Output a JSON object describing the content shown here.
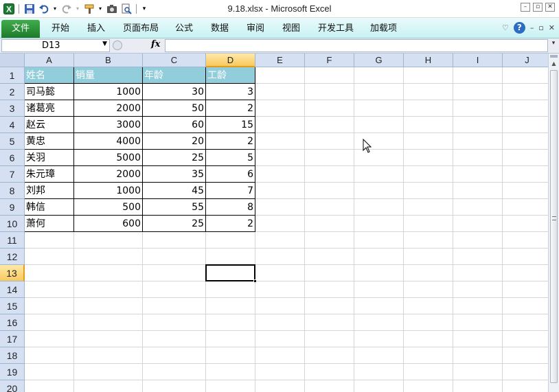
{
  "window": {
    "title": "9.18.xlsx - Microsoft Excel",
    "minimize_label": "–",
    "restore_label": "▫",
    "close_label": "✕"
  },
  "quick_access": {
    "icons": [
      "excel-logo-icon",
      "save-icon",
      "undo-icon",
      "redo-icon",
      "format-painter-icon",
      "camera-icon",
      "print-preview-icon",
      "customize-qat-icon"
    ]
  },
  "ribbon": {
    "file_tab": "文件",
    "tabs": [
      "开始",
      "插入",
      "页面布局",
      "公式",
      "数据",
      "审阅",
      "视图",
      "开发工具",
      "加载项"
    ],
    "collapse_label": "♡",
    "help_label": "?",
    "min_label": "–",
    "restore_label": "▫",
    "close_label": "✕"
  },
  "formula_bar": {
    "name_box": "D13",
    "fx_label": "fx",
    "formula": ""
  },
  "sheet": {
    "columns": [
      "A",
      "B",
      "C",
      "D",
      "E",
      "F",
      "G",
      "H",
      "I",
      "J"
    ],
    "rows": [
      "1",
      "2",
      "3",
      "4",
      "5",
      "6",
      "7",
      "8",
      "9",
      "10",
      "11",
      "12",
      "13",
      "14",
      "15",
      "16",
      "17",
      "18",
      "19",
      "20"
    ],
    "selected_cell": "D13",
    "header_row": [
      "姓名",
      "销量",
      "年龄",
      "工龄"
    ],
    "header_fill": "#92cddc",
    "data_rows": [
      [
        "司马懿",
        "1000",
        "30",
        "3"
      ],
      [
        "诸葛亮",
        "2000",
        "50",
        "2"
      ],
      [
        "赵云",
        "3000",
        "60",
        "15"
      ],
      [
        "黄忠",
        "4000",
        "20",
        "2"
      ],
      [
        "关羽",
        "5000",
        "25",
        "5"
      ],
      [
        "朱元璋",
        "2000",
        "35",
        "6"
      ],
      [
        "刘邦",
        "1000",
        "45",
        "7"
      ],
      [
        "韩信",
        "500",
        "55",
        "8"
      ],
      [
        "萧何",
        "600",
        "25",
        "2"
      ]
    ]
  },
  "scrollbar": {
    "up_label": "▲"
  },
  "colors": {
    "file_tab": "#2e8f3a",
    "ribbon_bg": "#d6f5f6",
    "selection_header": "#f9c95e",
    "header_fill": "#92cddc"
  }
}
